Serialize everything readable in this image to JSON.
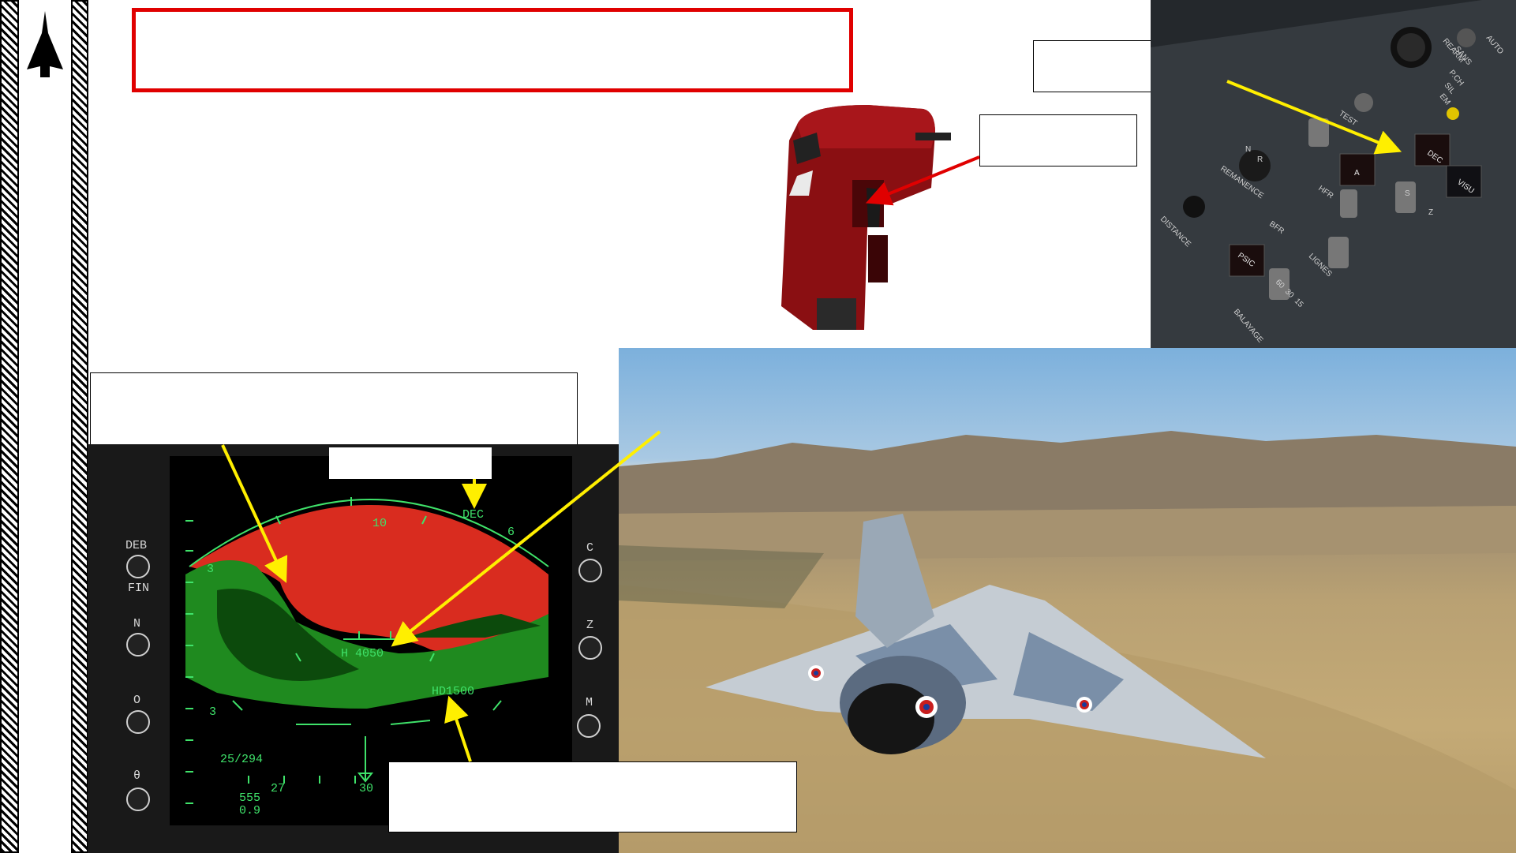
{
  "radar": {
    "left_buttons": [
      "DEB",
      "FIN",
      "N",
      "O",
      "θ"
    ],
    "right_buttons": [
      "C",
      "Z",
      "M"
    ],
    "scale_top": "10",
    "scale_left_upper": "3",
    "scale_left_lower": "3",
    "scale_right": "6",
    "mode_label": "DEC",
    "altitude": "H 4050",
    "hd_value": "HD1500",
    "range_readout": "25/294",
    "tick_27": "27",
    "tick_30": "30",
    "speed": "555",
    "mach": "0.9"
  },
  "cockpit_panel": {
    "labels": [
      "DEC",
      "VISU",
      "TEST",
      "REMANENCE",
      "DISTANCE",
      "BFR",
      "HFR",
      "LIGNES",
      "BALAYAGE",
      "PSIC",
      "REARM",
      "SANS",
      "AUTO",
      "P.CH",
      "SIL",
      "EM",
      "N",
      "R",
      "A",
      "S",
      "Z",
      "60",
      "30",
      "15"
    ]
  },
  "colors": {
    "title_border": "#e00000",
    "yellow_arrow": "#ffef00",
    "red_arrow": "#e00000",
    "radar_green": "#1f8a1f",
    "radar_red": "#d92c1f",
    "symbology": "#3fe26a"
  }
}
